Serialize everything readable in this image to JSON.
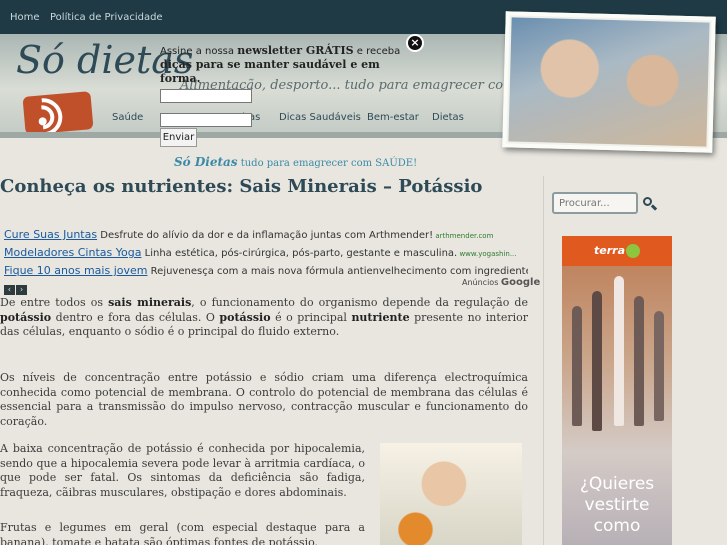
{
  "topbar": {
    "home": "Home",
    "privacy": "Política de Privacidade"
  },
  "header": {
    "title": "Só dietas",
    "tagline": "Alimentação, desporto... tudo para emagrecer com SAÚDE!",
    "nav": [
      "Saúde",
      "Receitas",
      "Dicas Saudáveis",
      "Bem-estar",
      "Dietas"
    ]
  },
  "newsletter": {
    "text_1": "Assine a nossa ",
    "text_2": "newsletter GRÁTIS",
    "text_3": " e receba ",
    "text_4": "dicas para se manter saudável e em forma.",
    "name_placeholder": "",
    "email_placeholder": "",
    "submit": "Enviar",
    "close": "×"
  },
  "subtitle": {
    "brand": "Só Dietas",
    "rest": " tudo para emagrecer com SAÚDE!"
  },
  "article": {
    "title": "Conheça os nutrientes: Sais Minerais – Potássio",
    "p1": [
      "De entre todos os ",
      "sais minerais",
      ", o funcionamento do organismo depende da regulação de ",
      "potássio",
      " dentro e fora das células. O ",
      "potássio",
      " é o principal ",
      "nutriente",
      " presente no interior das células, enquanto o sódio é o principal do fluido externo."
    ],
    "p2": "Os níveis de concentração entre potássio e sódio criam uma diferença electroquímica conhecida como potencial de membrana. O controlo do potencial de membrana das células é essencial para a transmissão do impulso nervoso, contracção muscular e funcionamento do coração.",
    "p3": "A baixa concentração de potássio é conhecida por hipocalemia, sendo que a hipocalemia severa pode levar à arritmia cardíaca, o que pode ser fatal. Os sintomas da deficiência são fadiga, fraqueza, cãibras musculares, obstipação e dores abdominais.",
    "p4": "Frutas e legumes em geral (com especial destaque para a banana), tomate e batata são óptimas fontes de potássio."
  },
  "ads": [
    {
      "head": "Cure Suas Juntas",
      "desc": " Desfrute do alívio da dor e da inflamação juntas com Arthmender!",
      "url": " arthmender.com"
    },
    {
      "head": "Modeladores Cintas Yoga",
      "desc": " Linha estética, pós-cirúrgica, pós-parto, gestante e masculina.",
      "url": " www.yogashin..."
    },
    {
      "head": "Fique 10 anos mais jovem",
      "desc": " Rejuvenesça com a mais nova fórmula antienvelhecimento com ingrediente...",
      "url": ""
    }
  ],
  "ad_label": {
    "prefix": "Anúncios ",
    "brand": "Google"
  },
  "sidebar": {
    "search_placeholder": "Procurar...",
    "terra_logo": "terra",
    "terra_text": "¿Quieres vestirte como"
  }
}
